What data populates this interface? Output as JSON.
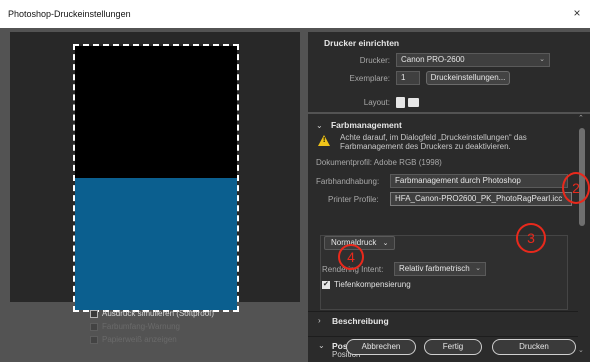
{
  "window": {
    "title": "Photoshop-Druckeinstellungen",
    "close_glyph": "×"
  },
  "printer_setup": {
    "title": "Drucker einrichten",
    "printer_label": "Drucker:",
    "printer_value": "Canon PRO-2600",
    "copies_label": "Exemplare:",
    "copies_value": "1",
    "settings_button": "Druckeinstellungen...",
    "layout_label": "Layout:"
  },
  "color_management": {
    "title": "Farbmanagement",
    "warning_text": "Achte darauf, im Dialogfeld „Druckeinstellungen“ das Farbmanagement des Druckers zu deaktivieren.",
    "document_profile": "Dokumentprofil: Adobe RGB (1998)",
    "color_handling_label": "Farbhandhabung:",
    "color_handling_value": "Farbmanagement durch Photoshop",
    "printer_profile_label": "Printer Profile:",
    "printer_profile_value": "HFA_Canon-PRO2600_PK_PhotoRagPearl.icc",
    "print_mode": "Normaldruck",
    "rendering_intent_label": "Rendering Intent:",
    "rendering_intent_value": "Relativ farbmetrisch",
    "black_point_label": "Tiefenkompensierung",
    "black_point_checked": true
  },
  "sections": {
    "description": "Beschreibung",
    "position_size": "Position und Größe",
    "position": "Position"
  },
  "preview_options": {
    "softproof_label": "Ausdruck simulieren (Softproof)",
    "gamut_warning_label": "Farbumfang-Warnung",
    "paper_white_label": "Papierweiß anzeigen"
  },
  "annotations": [
    "2",
    "3",
    "4"
  ],
  "buttons": {
    "cancel": "Abbrechen",
    "done": "Fertig",
    "print": "Drucken"
  },
  "colors": {
    "annotation": "#e8291c",
    "warning": "#f0c419",
    "print_fill_blue": "#0b5f8f"
  }
}
